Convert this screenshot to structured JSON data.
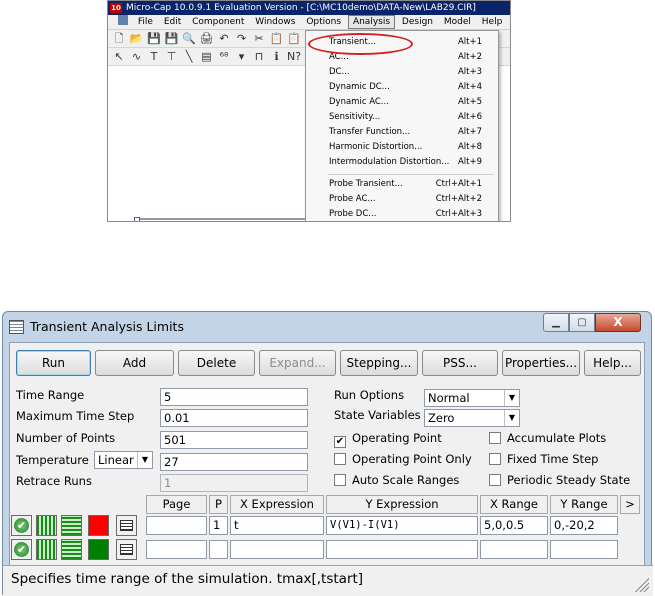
{
  "mc_window": {
    "title": "Micro-Cap 10.0.9.1 Evaluation Version - [C:\\MC10demo\\DATA-New\\LAB29.CIR]",
    "logo": "10",
    "menu": [
      "File",
      "Edit",
      "Component",
      "Windows",
      "Options",
      "Analysis",
      "Design",
      "Model",
      "Help"
    ],
    "active_menu": "Analysis",
    "toolbar1": [
      "🗋",
      "📂",
      "💾",
      "💾",
      "🔍",
      "🖨",
      "↶",
      "↷",
      "✂",
      "📋",
      "📋",
      "✕"
    ],
    "toolbar2": [
      "↖",
      "∿",
      "T",
      "⊤",
      "╲",
      "▤",
      "⁶⁸",
      "▾",
      "⊓",
      "ℹ",
      "N?",
      "⚙",
      "▣"
    ],
    "dropdown": [
      {
        "label": "Transient...",
        "accel": "Alt+1"
      },
      {
        "label": "AC...",
        "accel": "Alt+2"
      },
      {
        "label": "DC...",
        "accel": "Alt+3"
      },
      {
        "label": "Dynamic DC...",
        "accel": "Alt+4"
      },
      {
        "label": "Dynamic AC...",
        "accel": "Alt+5"
      },
      {
        "label": "Sensitivity...",
        "accel": "Alt+6"
      },
      {
        "label": "Transfer Function...",
        "accel": "Alt+7"
      },
      {
        "label": "Harmonic Distortion...",
        "accel": "Alt+8"
      },
      {
        "label": "Intermodulation Distortion...",
        "accel": "Alt+9"
      },
      {
        "label": "Probe Transient...",
        "accel": "Ctrl+Alt+1"
      },
      {
        "label": "Probe AC...",
        "accel": "Ctrl+Alt+2"
      },
      {
        "label": "Probe DC...",
        "accel": "Ctrl+Alt+3"
      }
    ],
    "highlight_color": "#d62020"
  },
  "dialog": {
    "title": "Transient Analysis Limits",
    "window_buttons": {
      "minimize": "▁",
      "maximize": "▢",
      "close": "X"
    },
    "buttons": {
      "run": "Run",
      "add": "Add",
      "delete": "Delete",
      "expand": "Expand...",
      "stepping": "Stepping...",
      "pss": "PSS...",
      "properties": "Properties...",
      "help": "Help..."
    },
    "labels": {
      "time_range": "Time Range",
      "max_time_step": "Maximum Time Step",
      "num_points": "Number of Points",
      "temperature": "Temperature",
      "retrace_runs": "Retrace Runs",
      "run_options": "Run Options",
      "state_variables": "State Variables"
    },
    "values": {
      "time_range": "5",
      "max_time_step": "0.01",
      "num_points": "501",
      "temperature_mode": "Linear",
      "temperature": "27",
      "retrace_runs": "1",
      "run_options": "Normal",
      "state_variables": "Zero"
    },
    "checkboxes": {
      "operating_point": {
        "label": "Operating Point",
        "checked": "✔"
      },
      "operating_point_only": {
        "label": "Operating Point Only",
        "checked": ""
      },
      "auto_scale_ranges": {
        "label": "Auto Scale Ranges",
        "checked": ""
      },
      "accumulate_plots": {
        "label": "Accumulate Plots",
        "checked": ""
      },
      "fixed_time_step": {
        "label": "Fixed Time Step",
        "checked": ""
      },
      "periodic_steady_state": {
        "label": "Periodic Steady State",
        "checked": ""
      }
    },
    "grid": {
      "headers": [
        "Page",
        "P",
        "X Expression",
        "Y Expression",
        "X Range",
        "Y Range",
        ">"
      ],
      "rows": [
        {
          "color": "#ff0000",
          "page": "",
          "p": "1",
          "x_expr": "t",
          "y_expr": "V(V1)-I(V1)",
          "x_range": "5,0,0.5",
          "y_range": "0,-20,2"
        },
        {
          "color": "#008000",
          "page": "",
          "p": "",
          "x_expr": "",
          "y_expr": "",
          "x_range": "",
          "y_range": ""
        }
      ],
      "ok_glyph": "✔"
    },
    "status": "Specifies time range of the simulation. tmax[,tstart]"
  }
}
